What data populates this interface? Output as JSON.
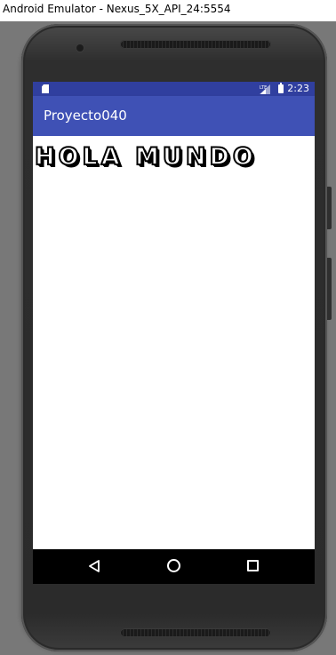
{
  "window": {
    "title": "Android Emulator - Nexus_5X_API_24:5554"
  },
  "status_bar": {
    "time": "2:23",
    "background_color": "#303f9f",
    "icons": [
      "sd-card-icon",
      "signal-lte-icon",
      "battery-icon"
    ]
  },
  "action_bar": {
    "title": "Proyecto040",
    "background_color": "#3f51b5"
  },
  "content": {
    "hello_text": "HOLA MUNDO"
  },
  "nav_bar": {
    "icons": [
      "back-icon",
      "home-icon",
      "recents-icon"
    ]
  }
}
